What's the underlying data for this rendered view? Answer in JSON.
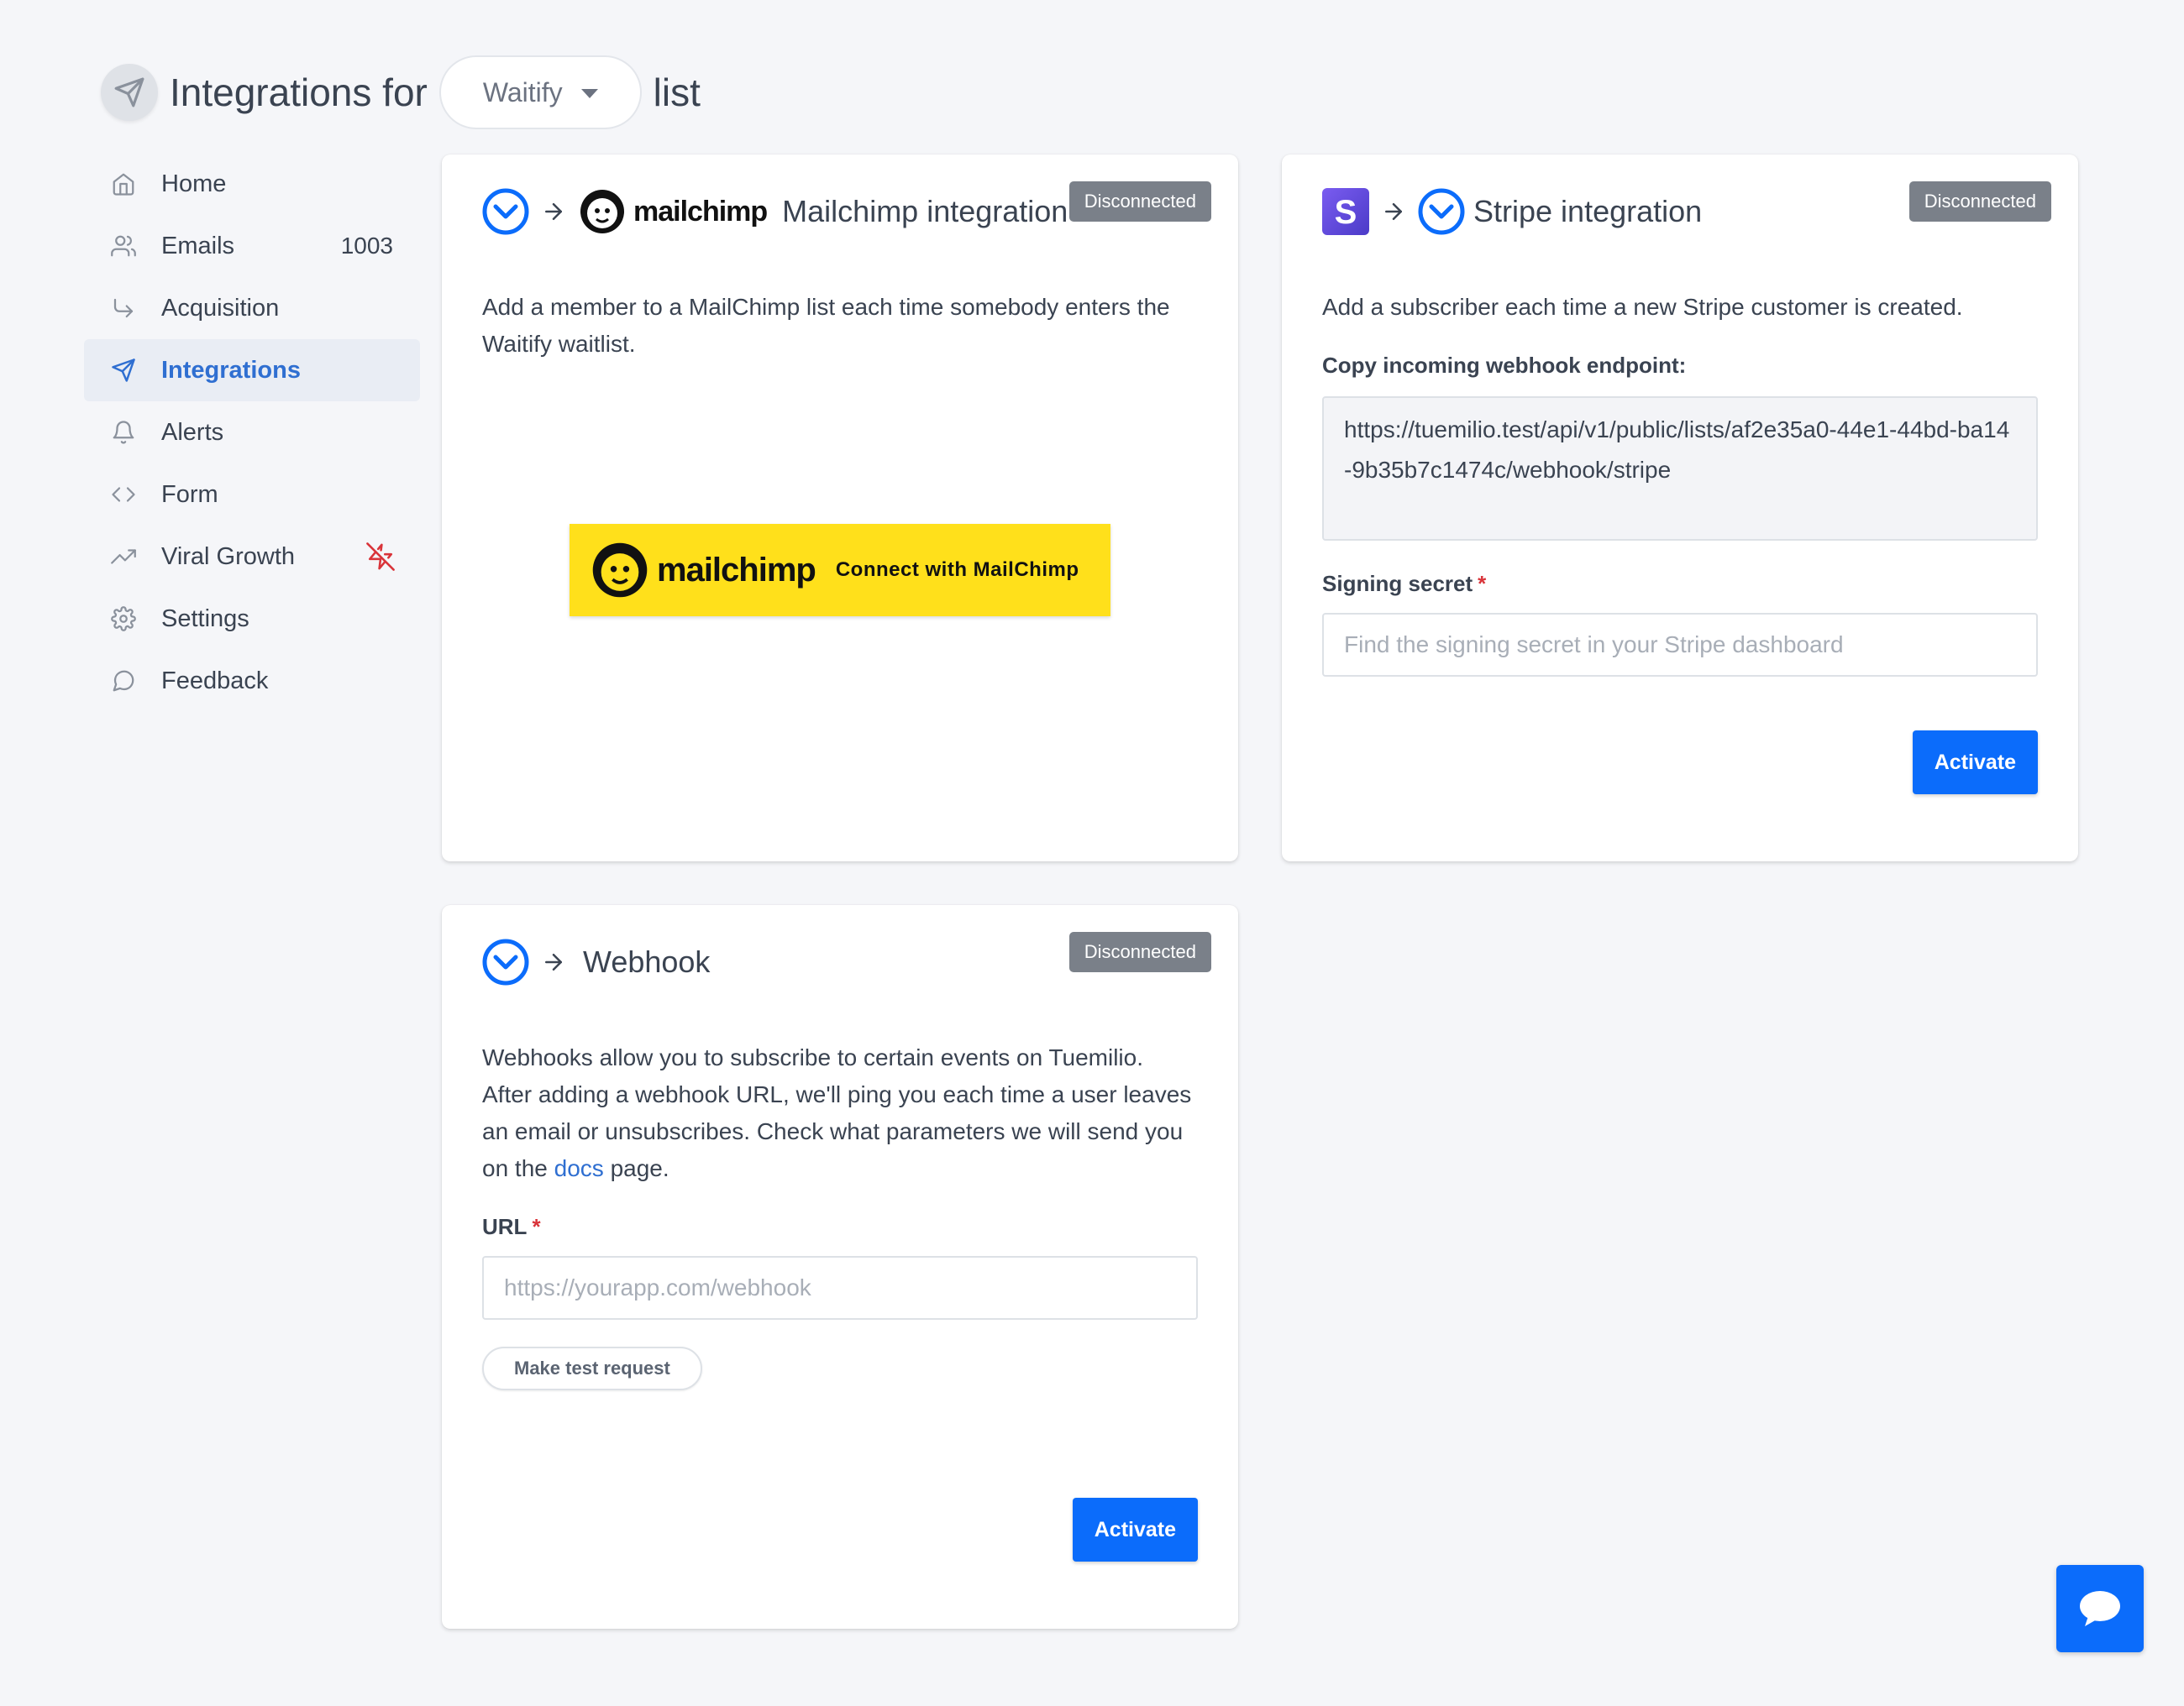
{
  "header": {
    "prefix": "Integrations for",
    "list_name": "Waitify",
    "suffix": "list"
  },
  "sidebar": {
    "items": [
      {
        "label": "Home",
        "icon": "home-icon"
      },
      {
        "label": "Emails",
        "icon": "users-icon",
        "count": "1003"
      },
      {
        "label": "Acquisition",
        "icon": "corner-down-right-icon"
      },
      {
        "label": "Integrations",
        "icon": "send-icon",
        "active": true
      },
      {
        "label": "Alerts",
        "icon": "bell-icon"
      },
      {
        "label": "Form",
        "icon": "code-icon"
      },
      {
        "label": "Viral Growth",
        "icon": "trending-up-icon",
        "badge_icon": "zap-off-icon"
      },
      {
        "label": "Settings",
        "icon": "gear-icon"
      },
      {
        "label": "Feedback",
        "icon": "message-circle-icon"
      }
    ]
  },
  "mailchimp": {
    "wordmark": "mailchimp",
    "title": "Mailchimp integration",
    "status": "Disconnected",
    "description": "Add a member to a MailChimp list each time somebody enters the Waitify waitlist.",
    "connect_label": "Connect with MailChimp"
  },
  "stripe": {
    "title": "Stripe integration",
    "status": "Disconnected",
    "description": "Add a subscriber each time a new Stripe customer is created.",
    "endpoint_label": "Copy incoming webhook endpoint:",
    "endpoint_value": "https://tuemilio.test/api/v1/public/lists/af2e35a0-44e1-44bd-ba14-9b35b7c1474c/webhook/stripe",
    "secret_label": "Signing secret",
    "required_mark": "*",
    "secret_placeholder": "Find the signing secret in your Stripe dashboard",
    "activate_label": "Activate"
  },
  "webhook": {
    "title": "Webhook",
    "status": "Disconnected",
    "description_before": "Webhooks allow you to subscribe to certain events on Tuemilio. After adding a webhook URL, we'll ping you each time a user leaves an email or unsubscribes. Check what parameters we will send you on the",
    "docs_link": "docs",
    "description_after": "page.",
    "url_label": "URL",
    "required_mark": "*",
    "url_placeholder": "https://yourapp.com/webhook",
    "test_label": "Make test request",
    "activate_label": "Activate"
  },
  "colors": {
    "primary": "#0b6cfb",
    "accent_blue": "#2f6fd1",
    "mailchimp_yellow": "#ffe01b",
    "badge_gray": "#7a8089",
    "required_red": "#d9343a"
  }
}
